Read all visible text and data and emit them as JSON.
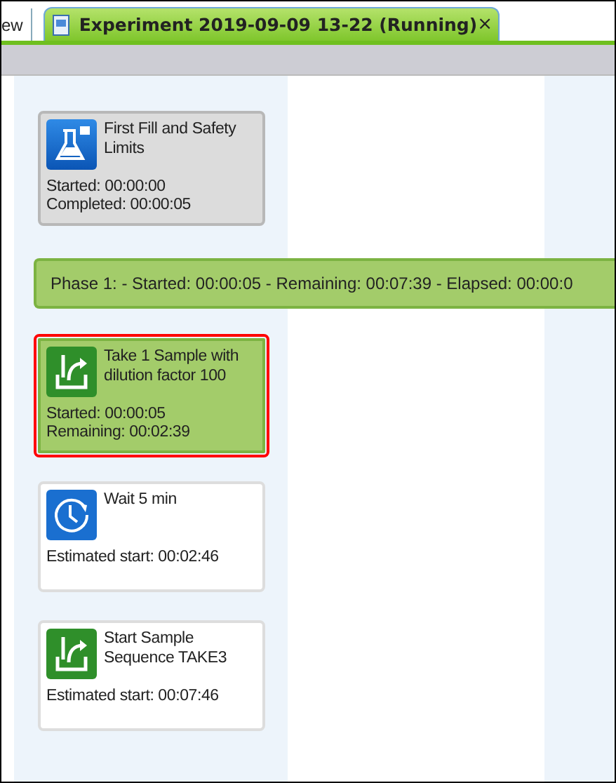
{
  "tabs": [
    {
      "label": "ew",
      "selected": false
    },
    {
      "label": "Experiment 2019-09-09 13-22 (Running)",
      "selected": true,
      "close": "×"
    }
  ],
  "steps": [
    {
      "kind": "flask",
      "completed": true,
      "running": false,
      "selected": false,
      "title": "First Fill and Safety Limits",
      "lines": [
        "Started: 00:00:00",
        "Completed: 00:00:05"
      ]
    },
    {
      "kind": "phase",
      "text": "Phase 1:  - Started: 00:00:05 - Remaining: 00:07:39 - Elapsed: 00:00:0"
    },
    {
      "kind": "sample",
      "completed": false,
      "running": true,
      "selected": true,
      "title": "Take 1 Sample with dilution factor 100",
      "lines": [
        "Started: 00:00:05",
        "Remaining: 00:02:39"
      ]
    },
    {
      "kind": "clock",
      "completed": false,
      "running": false,
      "selected": false,
      "title": "Wait 5 min",
      "lines": [
        "Estimated start: 00:02:46"
      ]
    },
    {
      "kind": "sample",
      "completed": false,
      "running": false,
      "selected": false,
      "title": "Start Sample Sequence TAKE3",
      "lines": [
        "Estimated start: 00:07:46"
      ]
    }
  ]
}
